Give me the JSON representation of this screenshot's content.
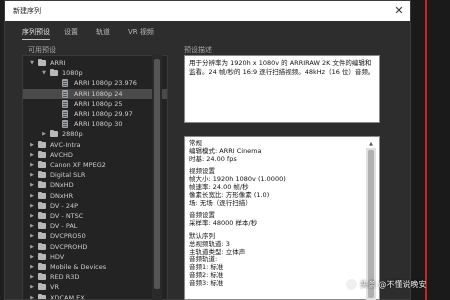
{
  "window": {
    "title": "新建序列",
    "close_glyph": "✕"
  },
  "tabs": [
    {
      "label": "序列预设",
      "active": true
    },
    {
      "label": "设置",
      "active": false
    },
    {
      "label": "轨道",
      "active": false
    },
    {
      "label": "VR 视频",
      "active": false
    }
  ],
  "presets_label": "可用预设",
  "description_label": "预设描述",
  "tree": [
    {
      "label": "ARRI",
      "type": "folder",
      "level": 0,
      "expanded": true
    },
    {
      "label": "1080p",
      "type": "folder",
      "level": 1,
      "expanded": true
    },
    {
      "label": "ARRI 1080p 23.976",
      "type": "file",
      "level": 2
    },
    {
      "label": "ARRI 1080p 24",
      "type": "file",
      "level": 2,
      "selected": true
    },
    {
      "label": "ARRI 1080p 25",
      "type": "file",
      "level": 2
    },
    {
      "label": "ARRI 1080p 29.97",
      "type": "file",
      "level": 2
    },
    {
      "label": "ARRI 1080p 30",
      "type": "file",
      "level": 2
    },
    {
      "label": "2880p",
      "type": "folder",
      "level": 1,
      "expanded": false
    },
    {
      "label": "AVC-Intra",
      "type": "folder",
      "level": 0,
      "expanded": false
    },
    {
      "label": "AVCHD",
      "type": "folder",
      "level": 0,
      "expanded": false
    },
    {
      "label": "Canon XF MPEG2",
      "type": "folder",
      "level": 0,
      "expanded": false
    },
    {
      "label": "Digital SLR",
      "type": "folder",
      "level": 0,
      "expanded": false
    },
    {
      "label": "DNxHD",
      "type": "folder",
      "level": 0,
      "expanded": false
    },
    {
      "label": "DNxHR",
      "type": "folder",
      "level": 0,
      "expanded": false
    },
    {
      "label": "DV - 24P",
      "type": "folder",
      "level": 0,
      "expanded": false
    },
    {
      "label": "DV - NTSC",
      "type": "folder",
      "level": 0,
      "expanded": false
    },
    {
      "label": "DV - PAL",
      "type": "folder",
      "level": 0,
      "expanded": false
    },
    {
      "label": "DVCPRO50",
      "type": "folder",
      "level": 0,
      "expanded": false
    },
    {
      "label": "DVCPROHD",
      "type": "folder",
      "level": 0,
      "expanded": false
    },
    {
      "label": "HDV",
      "type": "folder",
      "level": 0,
      "expanded": false
    },
    {
      "label": "Mobile & Devices",
      "type": "folder",
      "level": 0,
      "expanded": false
    },
    {
      "label": "RED R3D",
      "type": "folder",
      "level": 0,
      "expanded": false
    },
    {
      "label": "VR",
      "type": "folder",
      "level": 0,
      "expanded": false
    },
    {
      "label": "XDCAM EX",
      "type": "folder",
      "level": 0,
      "expanded": false
    }
  ],
  "description": "用于分辨率为 1920h x 1080v 的 ARRIRAW 2K 文件的编辑和监看。24 帧/秒的 16:9 逐行扫描视频。48kHz（16 位）音频。",
  "info_lines": [
    "常规",
    "编辑模式: ARRI Cinema",
    "时基: 24.00 fps",
    "",
    "视频设置",
    "帧大小: 1920h 1080v (1.0000)",
    "帧速率: 24.00 帧/秒",
    "像素长宽比: 方形像素 (1.0)",
    "场: 无场（逐行扫描）",
    "",
    "音频设置",
    "采样率: 48000 样本/秒",
    "",
    "默认序列",
    "总视频轨道: 3",
    "主轨道类型: 立体声",
    "音频轨道:",
    "音频1: 标准",
    "音频2: 标准",
    "音频3: 标准"
  ],
  "watermark": "头条 @不懂说晚安",
  "colors": {
    "dialog_bg": "#2d2d2d",
    "selected_row": "#4a4a4a",
    "accent_line": "#cc2222"
  }
}
